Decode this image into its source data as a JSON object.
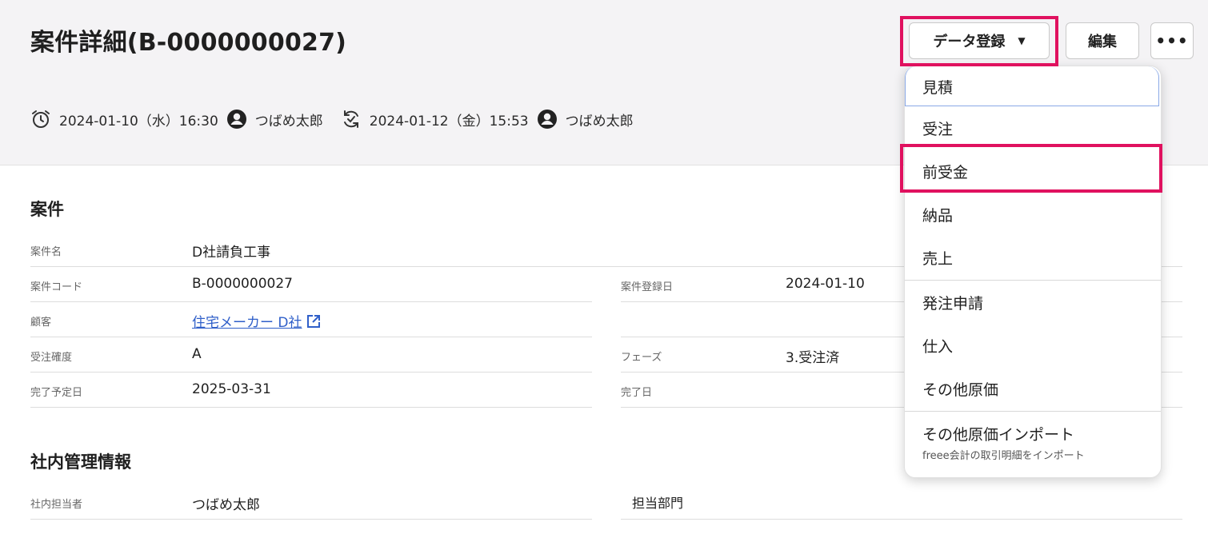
{
  "header": {
    "title": "案件詳細(B-0000000027)",
    "created_datetime": "2024-01-10（水）16:30",
    "created_by": "つばめ太郎",
    "updated_datetime": "2024-01-12（金）15:53",
    "updated_by": "つばめ太郎",
    "icons": [
      "alarm-clock-icon",
      "user-icon",
      "sync-icon",
      "user-icon"
    ]
  },
  "toolbar": {
    "data_register_label": "データ登録",
    "edit_label": "編集",
    "more_label": "•••"
  },
  "dropdown": {
    "items": [
      "見積",
      "受注",
      "前受金",
      "納品",
      "売上",
      "発注申請",
      "仕入",
      "その他原価",
      "その他原価インポート"
    ],
    "import_sub": "freee会計の取引明細をインポート"
  },
  "sections": {
    "project": {
      "title": "案件",
      "name_label": "案件名",
      "name": "D社請負工事",
      "code_label": "案件コード",
      "code": "B-0000000027",
      "reg_date_label": "案件登録日",
      "reg_date": "2024-01-10",
      "customer_label": "顧客",
      "customer": "住宅メーカー D社",
      "probability_label": "受注確度",
      "probability": "A",
      "phase_label": "フェーズ",
      "phase": "3.受注済",
      "planned_label": "完了予定日",
      "planned": "2025-03-31",
      "done_label": "完了日"
    },
    "internal": {
      "title": "社内管理情報",
      "staff_label": "社内担当者",
      "staff": "つばめ太郎",
      "dept_label": "担当部門"
    }
  },
  "colors": {
    "highlight": "#e0115f",
    "link": "#2f5fc9",
    "header_bg": "#f4f3f5"
  }
}
